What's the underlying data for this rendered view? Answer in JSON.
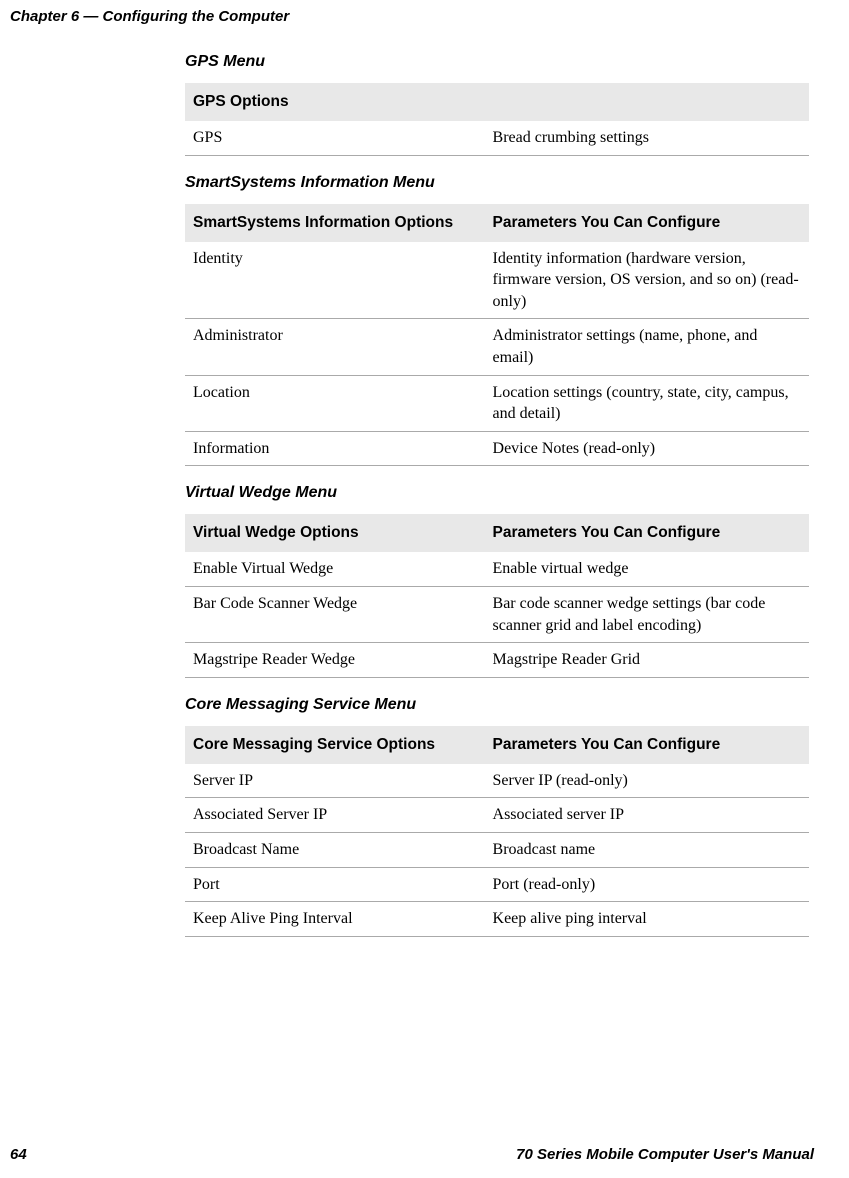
{
  "chapter_header": "Chapter 6 — Configuring the Computer",
  "sections": {
    "gps": {
      "title": "GPS Menu",
      "header1": "GPS Options",
      "header2": "",
      "rows": [
        {
          "o": "GPS",
          "p": "Bread crumbing settings"
        }
      ]
    },
    "smartsystems": {
      "title": "SmartSystems Information Menu",
      "header1": "SmartSystems Information Options",
      "header2": "Parameters You Can Configure",
      "rows": [
        {
          "o": "Identity",
          "p": "Identity information (hardware version, firmware version, OS version, and so on) (read-only)"
        },
        {
          "o": "Administrator",
          "p": "Administrator settings (name, phone, and email)"
        },
        {
          "o": "Location",
          "p": "Location settings (country, state, city, campus, and detail)"
        },
        {
          "o": "Information",
          "p": "Device Notes (read-only)"
        }
      ]
    },
    "virtualwedge": {
      "title": "Virtual Wedge Menu",
      "header1": "Virtual Wedge Options",
      "header2": "Parameters You Can Configure",
      "rows": [
        {
          "o": "Enable Virtual Wedge",
          "p": "Enable virtual wedge"
        },
        {
          "o": "Bar Code Scanner Wedge",
          "p": "Bar code scanner wedge settings (bar code scanner grid and label encoding)"
        },
        {
          "o": "Magstripe Reader Wedge",
          "p": "Magstripe Reader Grid"
        }
      ]
    },
    "coremessaging": {
      "title": "Core Messaging Service Menu",
      "header1": "Core Messaging Service Options",
      "header2": "Parameters You Can Configure",
      "rows": [
        {
          "o": "Server IP",
          "p": "Server IP (read-only)"
        },
        {
          "o": "Associated Server IP",
          "p": "Associated server IP"
        },
        {
          "o": "Broadcast Name",
          "p": "Broadcast name"
        },
        {
          "o": "Port",
          "p": "Port (read-only)"
        },
        {
          "o": "Keep Alive Ping Interval",
          "p": "Keep alive ping interval"
        }
      ]
    }
  },
  "footer": {
    "page_number": "64",
    "manual_title": "70 Series Mobile Computer User's Manual"
  }
}
